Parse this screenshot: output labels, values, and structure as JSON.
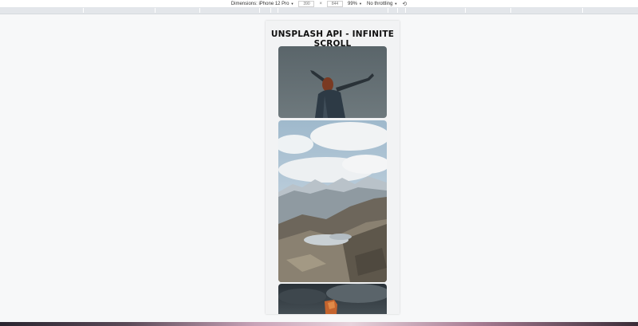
{
  "devtools": {
    "dimensions_label": "Dimensions: iPhone 12 Pro",
    "width_value": "390",
    "times": "×",
    "height_value": "844",
    "zoom": "99%",
    "throttle": "No throttling",
    "caret": "▼",
    "rotate_icon": "rotate-icon"
  },
  "app": {
    "title": "UNSPLASH API - INFINITE SCROLL"
  },
  "photos": [
    {
      "subject": "woman-arms-raised"
    },
    {
      "subject": "mountain-lake-landscape"
    },
    {
      "subject": "rock-formation-cloudy-sky"
    }
  ],
  "colors": {
    "page_bg": "#f7f8f9",
    "device_bg": "#f2f3f4",
    "title": "#111111"
  }
}
